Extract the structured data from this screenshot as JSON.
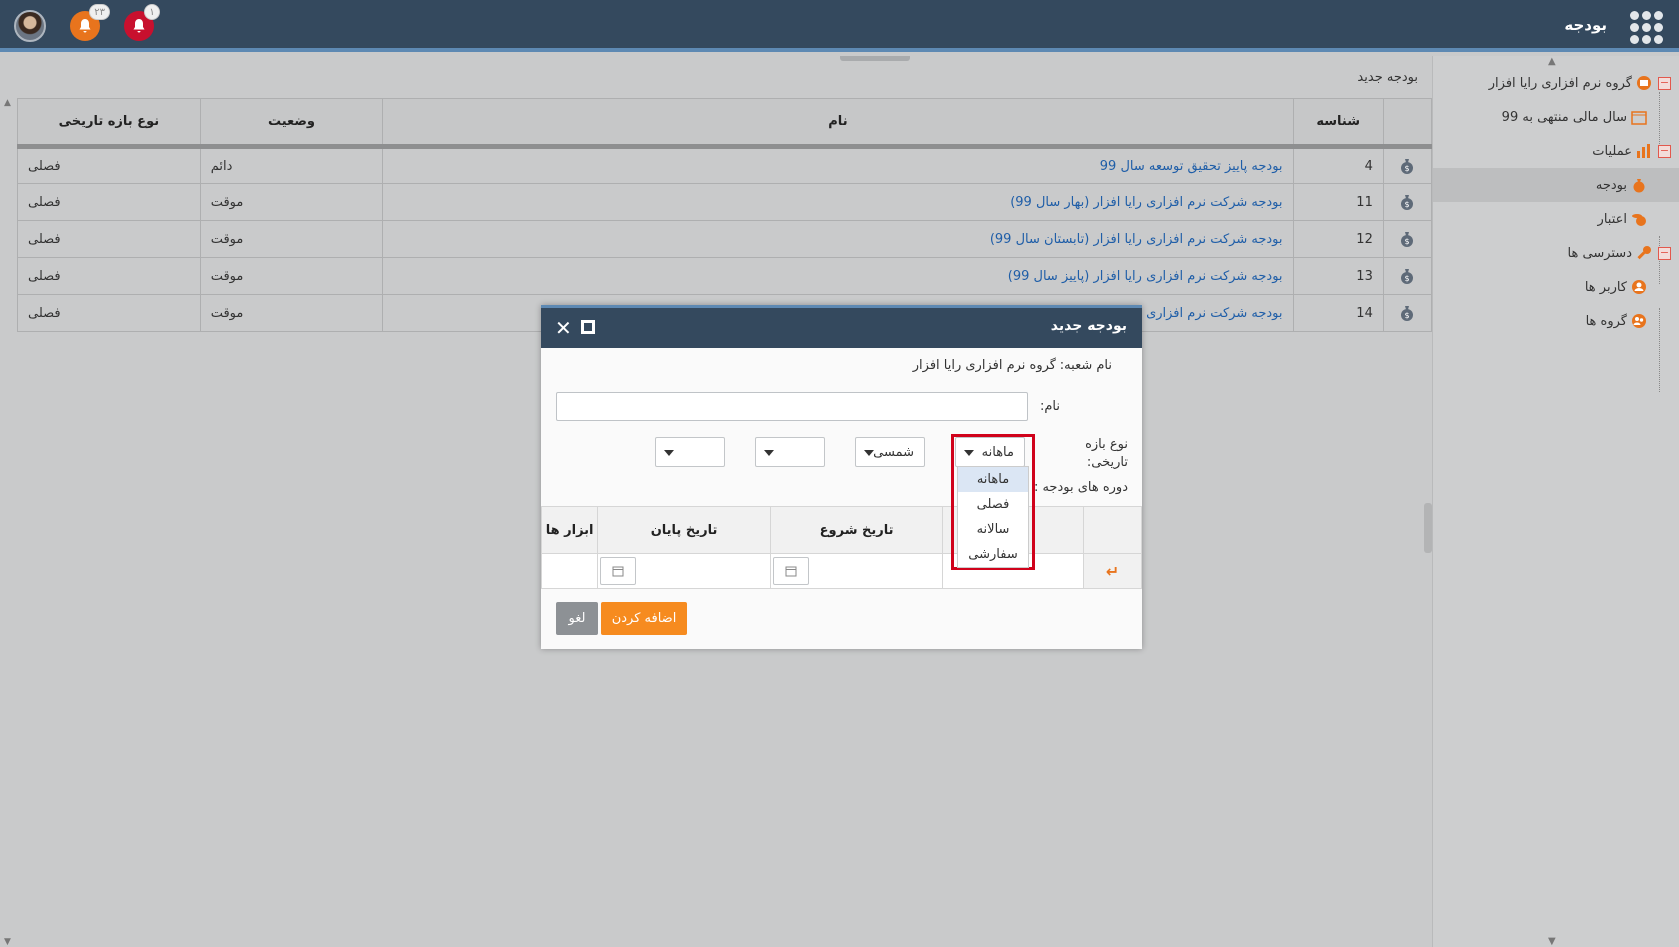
{
  "header": {
    "app_title": "بودجه",
    "notifications_orange_count": "۲۳",
    "notifications_red_count": "۱"
  },
  "sidebar": {
    "items": [
      {
        "label": "گروه نرم افزاری رایا افزار",
        "icon": "org-icon"
      },
      {
        "label": "سال مالی منتهی به 99",
        "icon": "calendar-icon"
      },
      {
        "label": "عملیات",
        "icon": "bar-chart-icon"
      },
      {
        "label": "بودجه",
        "icon": "money-bag-icon"
      },
      {
        "label": "اعتبار",
        "icon": "coins-icon"
      },
      {
        "label": "دسترسی ها",
        "icon": "key-icon"
      },
      {
        "label": "کاربر ها",
        "icon": "user-icon"
      },
      {
        "label": "گروه ها",
        "icon": "group-icon"
      }
    ]
  },
  "main": {
    "breadcrumb": "بودجه جدید",
    "columns": {
      "id": "شناسه",
      "name": "نام",
      "status": "وضعیت",
      "period_type": "نوع بازه تاریخی"
    },
    "rows": [
      {
        "id": "4",
        "name": "بودجه پاییز تحقیق توسعه سال 99",
        "status": "دائم",
        "period": "فصلی"
      },
      {
        "id": "11",
        "name": "بودجه شرکت نرم افزاری رایا افزار (بهار سال 99)",
        "status": "موقت",
        "period": "فصلی"
      },
      {
        "id": "12",
        "name": "بودجه شرکت نرم افزاری رایا افزار (تابستان سال 99)",
        "status": "موقت",
        "period": "فصلی"
      },
      {
        "id": "13",
        "name": "بودجه شرکت نرم افزاری رایا افزار (پاییز سال 99)",
        "status": "موقت",
        "period": "فصلی"
      },
      {
        "id": "14",
        "name": "بودجه شرکت نرم افزاری رایا",
        "status": "موقت",
        "period": "فصلی"
      }
    ]
  },
  "modal": {
    "title": "بودجه جدید",
    "branch_label": "نام شعبه:",
    "branch_value": "گروه نرم افزاری رایا افزار",
    "name_label": "نام:",
    "name_value": "",
    "period_type_label": "نوع بازه تاریخی:",
    "period_type_value": "ماهانه",
    "calendar_value": "شمسی",
    "periods_label": "دوره های بودجه :",
    "period_type_options": [
      "ماهانه",
      "فصلی",
      "سالانه",
      "سفارشی"
    ],
    "table_columns": {
      "start_date": "تاریخ شروع",
      "end_date": "تاریخ پایان",
      "tools": "ابزار ها"
    },
    "add_button": "اضافه کردن",
    "cancel_button": "لغو"
  },
  "colors": {
    "header_bg": "#34495e",
    "accent_orange": "#f68b1f",
    "link_blue": "#1f5ea8",
    "highlight_red": "#d0021b"
  }
}
